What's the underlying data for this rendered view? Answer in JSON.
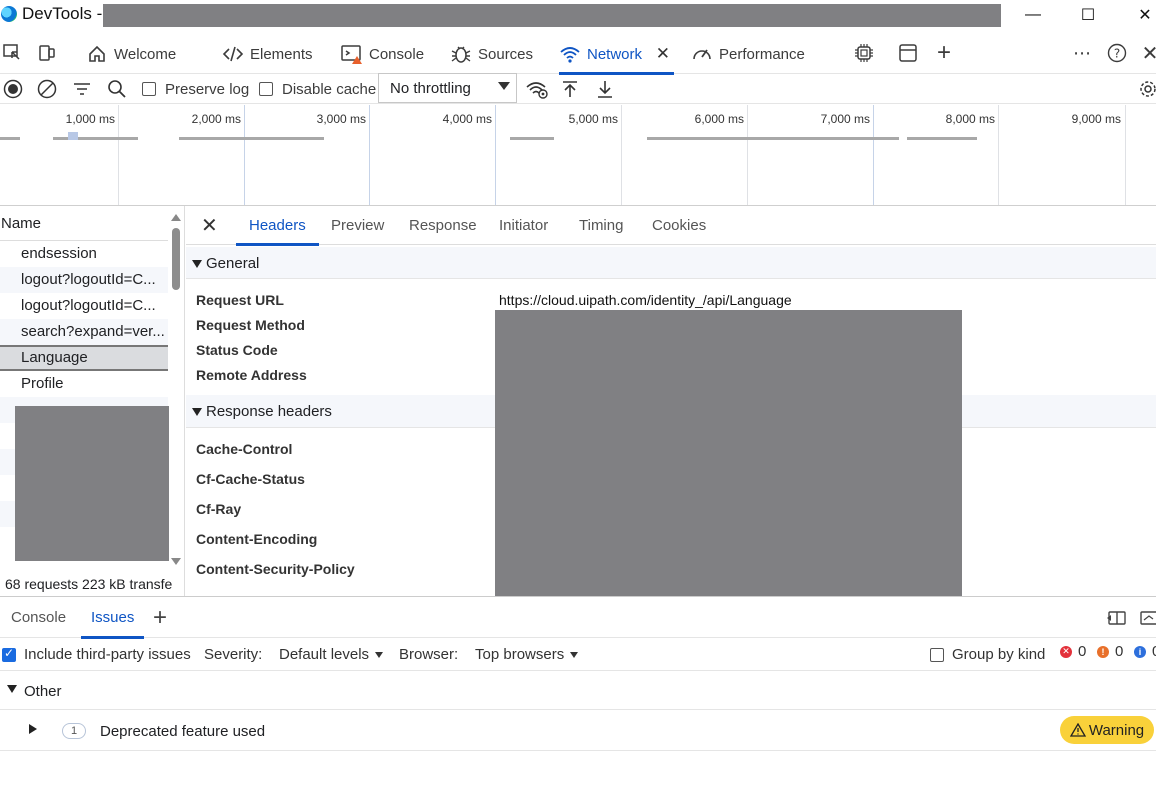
{
  "window": {
    "title": "DevTools -",
    "controls": {
      "minimize": "—",
      "maximize": "☐",
      "close": "✕"
    }
  },
  "main_tabs": [
    {
      "label": "Welcome",
      "icon": "home-icon"
    },
    {
      "label": "Elements",
      "icon": "code-icon"
    },
    {
      "label": "Console",
      "icon": "console-warning-icon"
    },
    {
      "label": "Sources",
      "icon": "bug-icon"
    },
    {
      "label": "Network",
      "icon": "wifi-icon",
      "active": true
    },
    {
      "label": "Performance",
      "icon": "gauge-icon"
    }
  ],
  "toolbar": {
    "preserve_log": "Preserve log",
    "disable_cache": "Disable cache",
    "throttling": "No throttling"
  },
  "timeline": {
    "labels": [
      "1,000 ms",
      "2,000 ms",
      "3,000 ms",
      "4,000 ms",
      "5,000 ms",
      "6,000 ms",
      "7,000 ms",
      "8,000 ms",
      "9,000 ms"
    ]
  },
  "request_list": {
    "header": "Name",
    "rows": [
      "endsession",
      "logout?logoutId=C...",
      "logout?logoutId=C...",
      "search?expand=ver...",
      "Language",
      "Profile"
    ],
    "selected_index": 4,
    "status": "68 requests   223 kB transfe"
  },
  "details": {
    "tabs": [
      "Headers",
      "Preview",
      "Response",
      "Initiator",
      "Timing",
      "Cookies"
    ],
    "active_tab": "Headers",
    "general_title": "General",
    "general": [
      {
        "name": "Request URL",
        "value": "https://cloud.uipath.com/identity_/api/Language"
      },
      {
        "name": "Request Method",
        "value": ""
      },
      {
        "name": "Status Code",
        "value": ""
      },
      {
        "name": "Remote Address",
        "value": ""
      }
    ],
    "response_headers_title": "Response headers",
    "response_headers": [
      "Cache-Control",
      "Cf-Cache-Status",
      "Cf-Ray",
      "Content-Encoding",
      "Content-Security-Policy"
    ]
  },
  "drawer": {
    "tabs": [
      "Console",
      "Issues"
    ],
    "active_tab": "Issues",
    "include_third_party": "Include third-party issues",
    "severity_label": "Severity:",
    "severity_value": "Default levels",
    "browser_label": "Browser:",
    "browser_value": "Top browsers",
    "group_by_kind": "Group by kind",
    "counts": {
      "errors": "0",
      "warnings": "0",
      "info": "0"
    },
    "group": "Other",
    "issue": {
      "count": "1",
      "title": "Deprecated feature used",
      "level": "Warning"
    }
  },
  "colors": {
    "accent": "#0f55c4",
    "redaction": "#808083",
    "warning": "#f9d13a"
  }
}
